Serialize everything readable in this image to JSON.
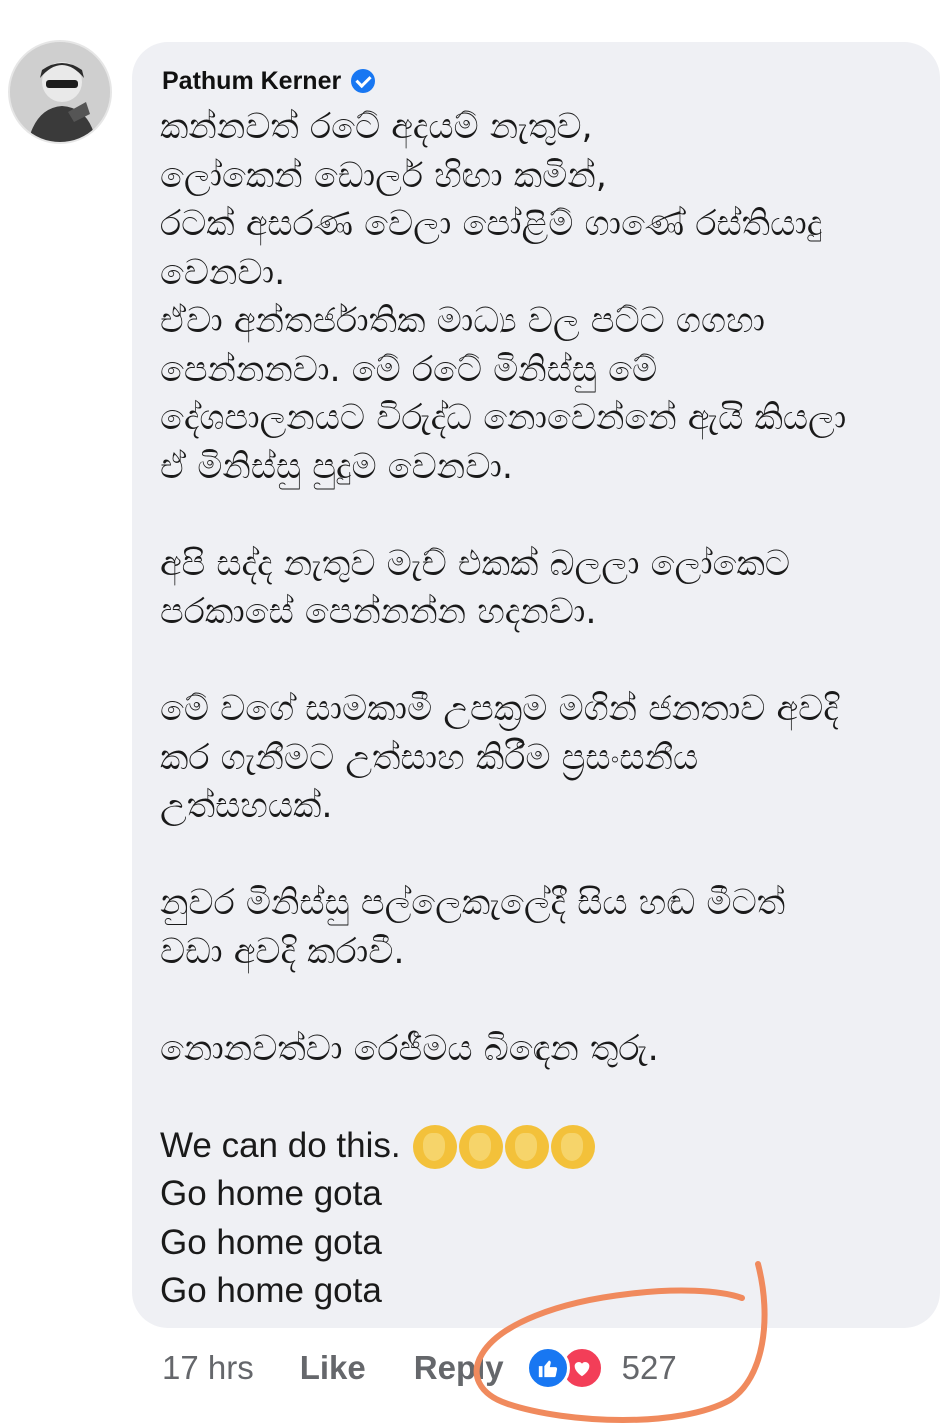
{
  "comment": {
    "author": "Pathum Kerner",
    "verified": true,
    "paragraphs": [
      [
        "කන්නවත් රටේ අදයම් නැතුව,",
        "ලෝකෙන් ඩොලර් හිඟා කමින්,",
        "රටක් අසරණ වෙලා පෝළිම් ගාණේ රස්තියාදු",
        "වෙනවා.",
        "ඒවා අන්තර්ජාතික මාධ්‍ය වල පට්ට ගගහා",
        "පෙන්නනවා. මේ රටේ මිනිස්සු මේ",
        "දේශපාලනයට විරුද්ධ නොවෙන්නේ ඇයි කියලා",
        "ඒ මිනිස්සු පුදුම වෙනවා."
      ],
      [
        "අපි සද්ද නැතුව මැච් එකක් බලලා ලෝකෙට",
        "පරකාසේ පෙන්නන්න හදනවා."
      ],
      [
        "මේ වගේ සාමකාමී උපක්‍රම මගින් ජනතාව අවදි",
        "කර ගැනීමට උත්සාහ කිරීම ප්‍රසංසනීය",
        "උත්සහයක්."
      ],
      [
        "නුවර මිනිස්සු පල්ලෙකැලේදී සිය හඬ මීටත්",
        "වඩා අවදි කරාවී."
      ],
      [
        "නොනවත්වා රෙජීමය බිඳෙන තුරු."
      ]
    ],
    "english_lead": "We can do this.",
    "emoji": [
      "clapping-hands",
      "clapping-hands",
      "clapping-hands",
      "clapping-hands"
    ],
    "english_lines": [
      "Go home gota",
      "Go home gota",
      "Go home gota"
    ]
  },
  "footer": {
    "time": "17 hrs",
    "like_label": "Like",
    "reply_label": "Reply",
    "reactions": [
      "like",
      "love"
    ],
    "reaction_count": "527"
  },
  "colors": {
    "bubble": "#eff0f4",
    "meta_text": "#65676b",
    "like_blue": "#1877f2",
    "love_red": "#f33e58",
    "annotation": "#f08a5d"
  }
}
